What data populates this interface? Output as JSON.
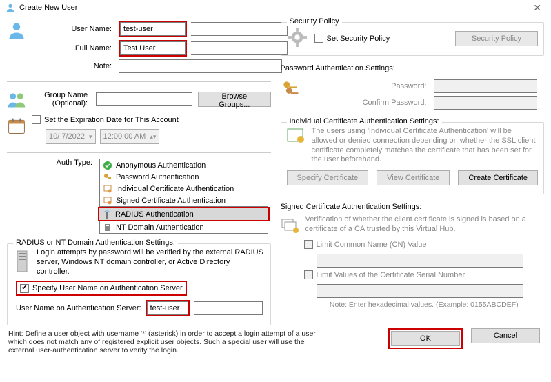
{
  "window": {
    "title": "Create New User"
  },
  "left": {
    "user_name_lbl": "User Name:",
    "user_name_val": "test-user",
    "full_name_lbl": "Full Name:",
    "full_name_val": "Test User",
    "note_lbl": "Note:",
    "note_val": "",
    "group_lbl": "Group Name\n(Optional):",
    "group_val": "",
    "browse_btn": "Browse Groups...",
    "exp_chk": "Set the Expiration Date for This Account",
    "exp_date": "10/ 7/2022",
    "exp_time": "12:00:00 AM",
    "auth_type_lbl": "Auth Type:",
    "auth_items": [
      "Anonymous Authentication",
      "Password Authentication",
      "Individual Certificate Authentication",
      "Signed Certificate Authentication",
      "RADIUS Authentication",
      "NT Domain Authentication"
    ],
    "radius_box_title": "RADIUS or NT Domain Authentication Settings:",
    "radius_desc": "Login attempts by password will be verified by the external RADIUS server, Windows NT domain controller, or Active Directory controller.",
    "specify_chk": "Specify User Name on Authentication Server",
    "auth_user_lbl": "User Name on Authentication Server:",
    "auth_user_val": "test-user"
  },
  "right": {
    "secpol_title": "Security Policy",
    "secpol_chk": "Set Security Policy",
    "secpol_btn": "Security Policy",
    "pw_title": "Password Authentication Settings:",
    "pw_lbl": "Password:",
    "pw_conf_lbl": "Confirm Password:",
    "ica_title": "Individual Certificate Authentication Settings:",
    "ica_desc": "The users using 'Individual Certificate Authentication' will be allowed or denied connection depending on whether the SSL client certificate completely matches the certificate that has been set for the user beforehand.",
    "spec_btn": "Specify Certificate",
    "view_btn": "View Certificate",
    "create_btn": "Create Certificate",
    "sca_title": "Signed Certificate Authentication Settings:",
    "sca_desc": "Verification of whether the client certificate is signed is based on a certificate of a CA trusted by this Virtual Hub.",
    "cn_chk": "Limit Common Name (CN) Value",
    "sn_chk": "Limit Values of the Certificate Serial Number",
    "sn_note": "Note: Enter hexadecimal values. (Example: 0155ABCDEF)"
  },
  "hint": "Hint: Define a user object with username '*' (asterisk) in order to accept a login attempt of a user which does not match any of registered explicit user objects. Such a special user will use the external user-authentication server to verify the login.",
  "buttons": {
    "ok": "OK",
    "cancel": "Cancel"
  }
}
